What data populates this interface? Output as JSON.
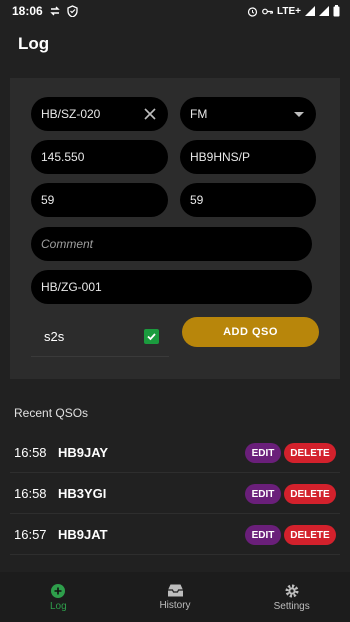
{
  "status_bar": {
    "time": "18:06",
    "network_label": "LTE+",
    "icons": [
      "sync-icon",
      "shield-icon",
      "alarm-icon",
      "key-icon",
      "signal-icon",
      "signal-icon",
      "battery-icon"
    ]
  },
  "header": {
    "title": "Log"
  },
  "form": {
    "summit_ref": "HB/SZ-020",
    "mode": "FM",
    "frequency": "145.550",
    "callsign": "HB9HNS/P",
    "rst_sent": "59",
    "rst_received": "59",
    "comment_placeholder": "Comment",
    "s2s_ref": "HB/ZG-001",
    "s2s_label": "s2s",
    "s2s_checked": true,
    "add_label": "ADD QSO"
  },
  "recent": {
    "title": "Recent QSOs",
    "edit_label": "EDIT",
    "delete_label": "DELETE",
    "items": [
      {
        "time": "16:58",
        "call": "HB9JAY"
      },
      {
        "time": "16:58",
        "call": "HB3YGI"
      },
      {
        "time": "16:57",
        "call": "HB9JAT"
      }
    ]
  },
  "nav": {
    "items": [
      {
        "label": "Log",
        "icon": "add-circle-icon",
        "active": true
      },
      {
        "label": "History",
        "icon": "inbox-icon",
        "active": false
      },
      {
        "label": "Settings",
        "icon": "gear-icon",
        "active": false
      }
    ]
  },
  "colors": {
    "accent_green": "#2e9e4b",
    "add_button": "#b8860b",
    "edit_button": "#6a1f7a",
    "delete_button": "#d3212c"
  }
}
